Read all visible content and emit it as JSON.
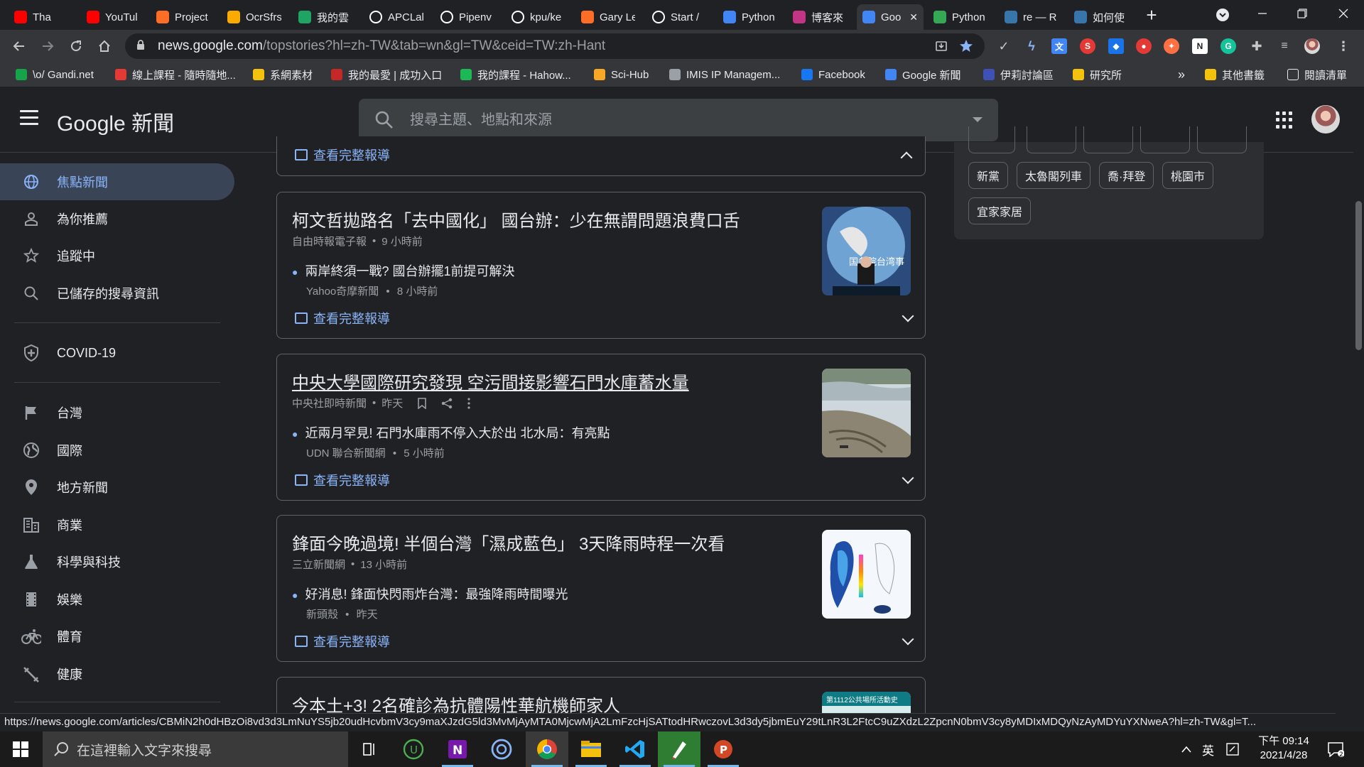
{
  "browser": {
    "tabs": [
      {
        "label": "Tha",
        "icon": "youtube-icon",
        "color": "#ff0000"
      },
      {
        "label": "YouTul",
        "icon": "youtube-icon",
        "color": "#ff0000"
      },
      {
        "label": "Project",
        "icon": "gitlab-icon",
        "color": "#fc6d26"
      },
      {
        "label": "OcrSfrs",
        "icon": "star-icon",
        "color": "#f9ab00"
      },
      {
        "label": "我的雲",
        "icon": "google-drive-icon",
        "color": "#1fa463"
      },
      {
        "label": "APCLal",
        "icon": "github-icon",
        "color": "#ffffff"
      },
      {
        "label": "Pipenv",
        "icon": "medium-icon",
        "color": "#ffffff"
      },
      {
        "label": "kpu/ke",
        "icon": "github-icon",
        "color": "#ffffff"
      },
      {
        "label": "Gary Le",
        "icon": "gitlab-icon",
        "color": "#fc6d26"
      },
      {
        "label": "Start /",
        "icon": "page-icon",
        "color": "#ffffff"
      },
      {
        "label": "Python",
        "icon": "google-docs-icon",
        "color": "#4285f4"
      },
      {
        "label": "博客來",
        "icon": "instagram-icon",
        "color": "#c13584"
      },
      {
        "label": "Goo",
        "icon": "google-news-icon",
        "color": "#4285f4"
      },
      {
        "label": "Python",
        "icon": "chat-icon",
        "color": "#34a853"
      },
      {
        "label": "re — R",
        "icon": "python-icon",
        "color": "#3776ab"
      },
      {
        "label": "如何使",
        "icon": "python-icon",
        "color": "#3776ab"
      }
    ],
    "new_tab_symbol": "+",
    "url_host": "news.google.com",
    "url_path": "/topstories?hl=zh-TW&tab=wn&gl=TW&ceid=TW:zh-Hant",
    "bookmarks": [
      {
        "label": "\\o/ Gandi.net",
        "icon": "gandi-icon",
        "color": "#16a34a"
      },
      {
        "label": "線上課程 - 隨時隨地...",
        "icon": "course-icon",
        "color": "#e53935"
      },
      {
        "label": "系網素材",
        "icon": "folder-icon",
        "color": "#f4c20d"
      },
      {
        "label": "我的最愛 | 成功入口",
        "icon": "ncku-icon",
        "color": "#c62828"
      },
      {
        "label": "我的課程 - Hahow...",
        "icon": "hahow-icon",
        "color": "#1db954"
      },
      {
        "label": "Sci-Hub",
        "icon": "scihub-icon",
        "color": "#f9a825"
      },
      {
        "label": "IMIS IP Managem...",
        "icon": "globe-icon",
        "color": "#9aa0a6"
      },
      {
        "label": "Facebook",
        "icon": "facebook-icon",
        "color": "#1877f2"
      },
      {
        "label": "Google 新聞",
        "icon": "google-news-icon",
        "color": "#4285f4"
      },
      {
        "label": "伊莉討論區",
        "icon": "eyny-icon",
        "color": "#3f51b5"
      },
      {
        "label": "研究所",
        "icon": "folder-icon",
        "color": "#f4c20d"
      }
    ],
    "bookmarks_overflow": "»",
    "other_bookmarks": "其他書籤",
    "reading_list": "閱讀清單"
  },
  "header": {
    "logo_text": "Google 新聞",
    "search_placeholder": "搜尋主題、地點和來源"
  },
  "nav": {
    "items": [
      {
        "label": "焦點新聞",
        "icon": "globe-icon",
        "selected": true
      },
      {
        "label": "為你推薦",
        "icon": "person-icon",
        "selected": false
      },
      {
        "label": "追蹤中",
        "icon": "star-icon",
        "selected": false
      },
      {
        "label": "已儲存的搜尋資訊",
        "icon": "search-icon",
        "selected": false
      },
      {
        "label": "COVID-19",
        "icon": "health-shield-icon",
        "selected": false
      },
      {
        "label": "台灣",
        "icon": "flag-icon",
        "selected": false
      },
      {
        "label": "國際",
        "icon": "globe-world-icon",
        "selected": false
      },
      {
        "label": "地方新聞",
        "icon": "location-pin-icon",
        "selected": false
      },
      {
        "label": "商業",
        "icon": "building-icon",
        "selected": false
      },
      {
        "label": "科學與科技",
        "icon": "flask-icon",
        "selected": false
      },
      {
        "label": "娛樂",
        "icon": "film-icon",
        "selected": false
      },
      {
        "label": "體育",
        "icon": "bicycle-icon",
        "selected": false
      },
      {
        "label": "健康",
        "icon": "fitness-icon",
        "selected": false
      }
    ]
  },
  "feed": {
    "full_coverage_label": "查看完整報導",
    "stories": [
      {
        "title": "柯文哲拋路名「去中國化」 國台辦：少在無謂問題浪費口舌",
        "source": "自由時報電子報",
        "time": "9 小時前",
        "sub_title": "兩岸終須一戰? 國台辦擺1前提可解決",
        "sub_source": "Yahoo奇摩新聞",
        "sub_time": "8 小時前",
        "thumb": "press-conference-image",
        "hovered": false
      },
      {
        "title": "中央大學國際研究發現 空污間接影響石門水庫蓄水量",
        "source": "中央社即時新聞",
        "time": "昨天",
        "sub_title": "近兩月罕見! 石門水庫雨不停入大於出 北水局：有亮點",
        "sub_source": "UDN 聯合新聞網",
        "sub_time": "5 小時前",
        "thumb": "reservoir-image",
        "hovered": true
      },
      {
        "title": "鋒面今晚過境! 半個台灣「濕成藍色」 3天降雨時程一次看",
        "source": "三立新聞網",
        "time": "13 小時前",
        "sub_title": "好消息! 鋒面快閃雨炸台灣：最強降雨時間曝光",
        "sub_source": "新頭殼",
        "sub_time": "昨天",
        "thumb": "rain-map-image",
        "hovered": false
      },
      {
        "title": "今本土+3! 2名確診為抗體陽性華航機師家人",
        "thumb_caption": "第1112公共場所活動史",
        "thumb": "covid-info-image"
      }
    ]
  },
  "topics": {
    "chips": [
      "新黨",
      "太魯閣列車",
      "喬·拜登",
      "桃園市",
      "宜家家居"
    ]
  },
  "status_url": "https://news.google.com/articles/CBMiN2h0dHBzOi8vd3d3LmNuYS5jb20udHcvbmV3cy9maXJzdG5ld3MvMjAyMTA0MjcwMjA2LmFzcHjSATtodHRwczovL3d3dy5jbmEuY29tLnR3L2FtcC9uZXdzL2ZpcnN0bmV3cy8yMDIxMDQyNzAyMDYuYXNweA?hl=zh-TW&gl=T...",
  "taskbar": {
    "search_placeholder": "在這裡輸入文字來搜尋",
    "ime": "英",
    "time": "下午 09:14",
    "date": "2021/4/28"
  }
}
